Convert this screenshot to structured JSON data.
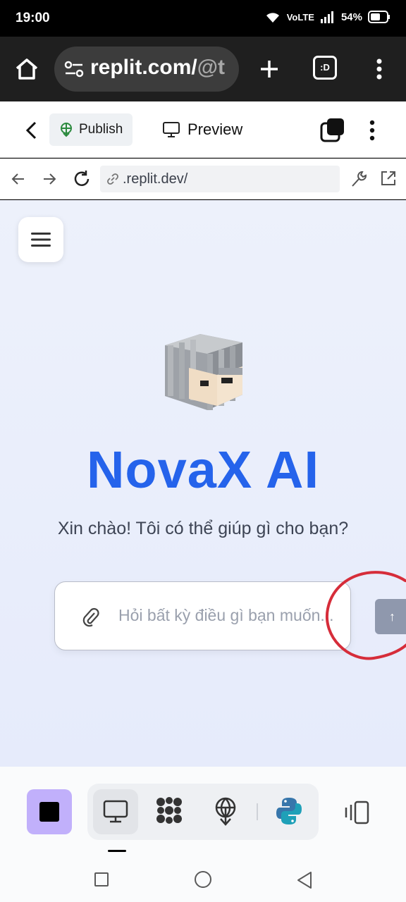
{
  "status_bar": {
    "time": "19:00",
    "network": "VoLTE",
    "battery": "54%"
  },
  "browser": {
    "url_main": "replit.com/",
    "url_dim": "@t",
    "tabs_label": ":D"
  },
  "replit_bar": {
    "publish_label": "Publish",
    "preview_label": "Preview"
  },
  "preview_nav": {
    "url": ".replit.dev/"
  },
  "app": {
    "title": "NovaX AI",
    "subtitle": "Xin chào! Tôi có thể giúp gì cho bạn?",
    "input_placeholder": "Hỏi bất kỳ điều gì bạn muốn...",
    "send_label": "↑"
  },
  "colors": {
    "title": "#2563eb",
    "stop_button": "#c1b0fb",
    "send_button": "#8f98ad",
    "annotation": "#d62d3a"
  },
  "icons": {
    "toolbar": [
      "monitor-icon",
      "mesh-icon",
      "deployments-icon",
      "python-icon"
    ],
    "layout": "layout-switch-icon"
  }
}
